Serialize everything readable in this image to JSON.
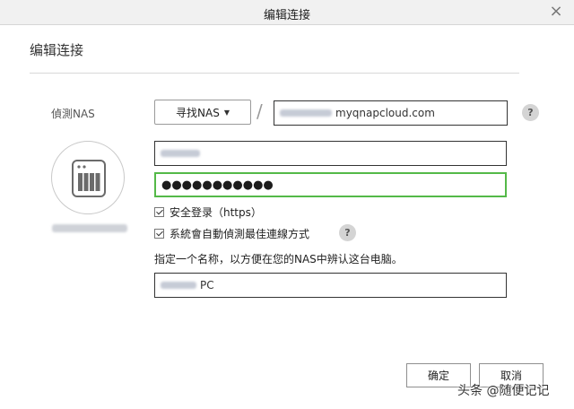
{
  "window": {
    "title": "编辑连接",
    "close_glyph": "×"
  },
  "heading": "编辑连接",
  "detect_label": "偵測NAS",
  "find_button": {
    "label": "寻找NAS",
    "caret": "▼"
  },
  "separator": "/",
  "host_field": {
    "value_suffix": "myqnapcloud.com"
  },
  "password_field": {
    "masked_value": "●●●●●●●●●●●"
  },
  "help_glyph": "?",
  "options": {
    "secure_login": {
      "label": "安全登录（https）",
      "checked": true
    },
    "auto_detect": {
      "label": "系統會自動偵測最佳連線方式",
      "checked": true
    }
  },
  "name_hint": "指定一个名称，以方便在您的NAS中辨认这台电脑。",
  "computer_name_field": {
    "value_suffix": "PC"
  },
  "buttons": {
    "ok": "确定",
    "cancel": "取消"
  },
  "watermark": "头条 @随便记记",
  "colors": {
    "focus_border": "#54b948",
    "help_bg": "#d4d4d4",
    "titlebar_bg": "#f1f1f1"
  },
  "icons": {
    "close": "close-icon",
    "nas": "nas-device-icon",
    "dropdown": "caret-down-icon",
    "help": "help-icon"
  }
}
